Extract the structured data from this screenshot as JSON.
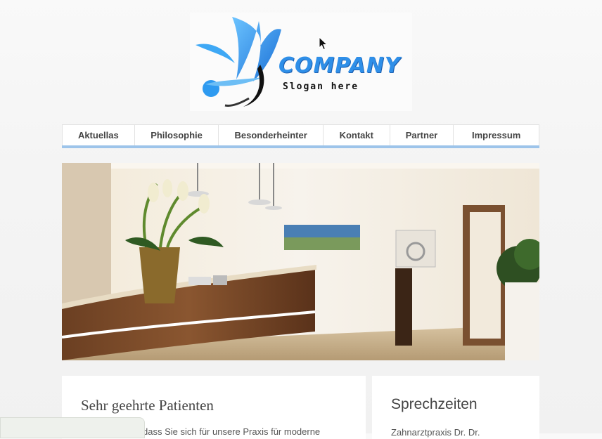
{
  "logo": {
    "company": "COMPANY",
    "slogan": "Slogan here"
  },
  "nav": {
    "items": [
      {
        "label": "Aktuellas"
      },
      {
        "label": "Philosophie"
      },
      {
        "label": "Besonderheinter"
      },
      {
        "label": "Kontakt"
      },
      {
        "label": "Partner"
      },
      {
        "label": "Impressum"
      }
    ],
    "accent_color": "#9dc4ea"
  },
  "hero": {
    "description": "Reception area photo"
  },
  "main": {
    "left": {
      "heading": "Sehr geehrte Patienten",
      "text": "dass Sie sich für unsere Praxis für moderne"
    },
    "right": {
      "heading": "Sprechzeiten",
      "text": "Zahnarztpraxis Dr. Dr."
    }
  },
  "icons": {
    "cursor": "mouse-pointer-icon"
  }
}
